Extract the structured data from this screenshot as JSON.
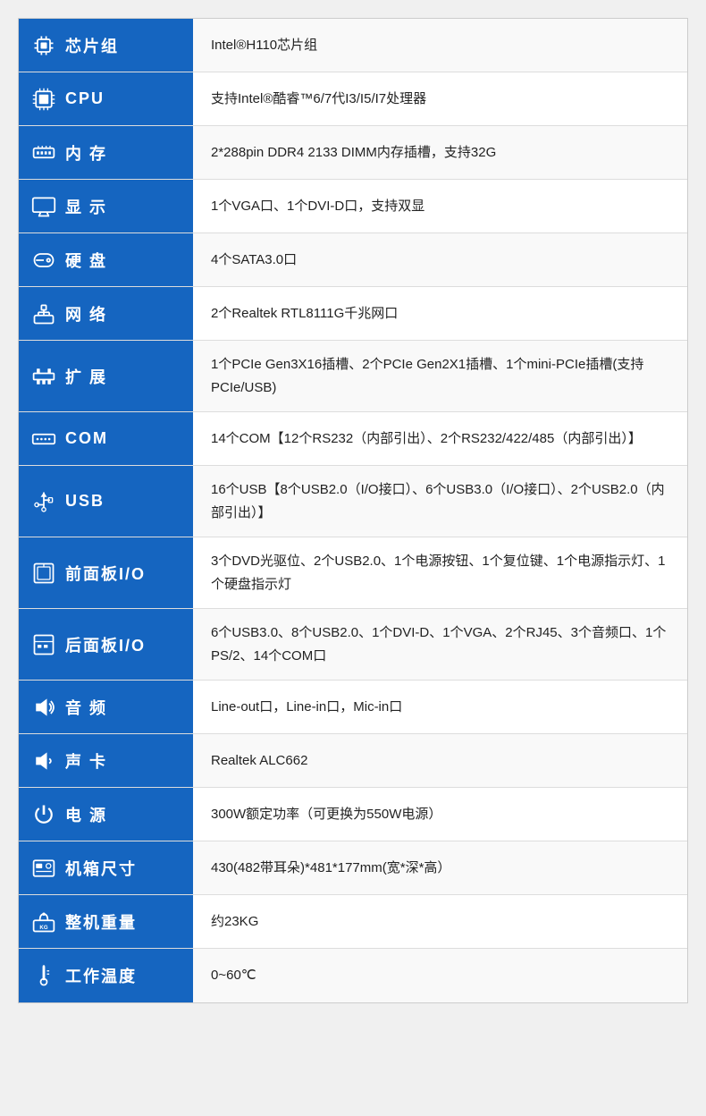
{
  "rows": [
    {
      "id": "chipset",
      "icon": "chipset-icon",
      "icon_glyph": "▦",
      "label": "芯片组",
      "value": "Intel®H110芯片组"
    },
    {
      "id": "cpu",
      "icon": "cpu-icon",
      "icon_glyph": "⬛",
      "label": "CPU",
      "value": "支持Intel®酷睿™6/7代I3/I5/I7处理器"
    },
    {
      "id": "memory",
      "icon": "memory-icon",
      "icon_glyph": "▬",
      "label": "内  存",
      "value": "2*288pin DDR4 2133 DIMM内存插槽，支持32G"
    },
    {
      "id": "display",
      "icon": "display-icon",
      "icon_glyph": "▭",
      "label": "显  示",
      "value": "1个VGA口、1个DVI-D口，支持双显"
    },
    {
      "id": "hdd",
      "icon": "hdd-icon",
      "icon_glyph": "💿",
      "label": "硬  盘",
      "value": "4个SATA3.0口"
    },
    {
      "id": "network",
      "icon": "network-icon",
      "icon_glyph": "🌐",
      "label": "网  络",
      "value": "2个Realtek RTL8111G千兆网口"
    },
    {
      "id": "expansion",
      "icon": "expansion-icon",
      "icon_glyph": "⬛",
      "label": "扩  展",
      "value": "1个PCIe Gen3X16插槽、2个PCIe Gen2X1插槽、1个mini-PCIe插槽(支持PCIe/USB)"
    },
    {
      "id": "com",
      "icon": "com-icon",
      "icon_glyph": "▬",
      "label": "COM",
      "value": "14个COM【12个RS232（内部引出）、2个RS232/422/485（内部引出）】"
    },
    {
      "id": "usb",
      "icon": "usb-icon",
      "icon_glyph": "⬛",
      "label": "USB",
      "value": "16个USB【8个USB2.0（I/O接口）、6个USB3.0（I/O接口）、2个USB2.0（内部引出）】"
    },
    {
      "id": "front-io",
      "icon": "front-io-icon",
      "icon_glyph": "▭",
      "label": "前面板I/O",
      "value": "3个DVD光驱位、2个USB2.0、1个电源按钮、1个复位键、1个电源指示灯、1个硬盘指示灯"
    },
    {
      "id": "rear-io",
      "icon": "rear-io-icon",
      "icon_glyph": "▭",
      "label": "后面板I/O",
      "value": "6个USB3.0、8个USB2.0、1个DVI-D、1个VGA、2个RJ45、3个音频口、1个PS/2、14个COM口"
    },
    {
      "id": "audio",
      "icon": "audio-icon",
      "icon_glyph": "🔊",
      "label": "音  频",
      "value": "Line-out口，Line-in口，Mic-in口"
    },
    {
      "id": "sound-card",
      "icon": "sound-card-icon",
      "icon_glyph": "🔊",
      "label": "声  卡",
      "value": "Realtek ALC662"
    },
    {
      "id": "power",
      "icon": "power-icon",
      "icon_glyph": "⚡",
      "label": "电  源",
      "value": "300W额定功率（可更换为550W电源）"
    },
    {
      "id": "chassis",
      "icon": "chassis-icon",
      "icon_glyph": "⬛",
      "label": "机箱尺寸",
      "value": "430(482带耳朵)*481*177mm(宽*深*高）"
    },
    {
      "id": "weight",
      "icon": "weight-icon",
      "icon_glyph": "⚖",
      "label": "整机重量",
      "value": "约23KG"
    },
    {
      "id": "temperature",
      "icon": "temperature-icon",
      "icon_glyph": "🌡",
      "label": "工作温度",
      "value": "0~60℃"
    }
  ],
  "colors": {
    "label_bg": "#1565c0",
    "label_text": "#ffffff",
    "value_bg_odd": "#f9f9f9",
    "value_bg_even": "#ffffff"
  }
}
